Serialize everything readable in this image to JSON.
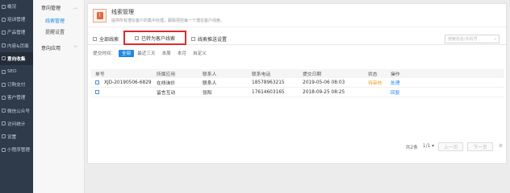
{
  "nav": [
    {
      "label": "概况",
      "icon": "overview-icon",
      "active": false
    },
    {
      "label": "培训管理",
      "icon": "training-icon",
      "active": false
    },
    {
      "label": "产品管理",
      "icon": "product-icon",
      "active": false
    },
    {
      "label": "内容&页面",
      "icon": "content-icon",
      "active": false
    },
    {
      "label": "意向收集",
      "icon": "intent-icon",
      "active": true
    },
    {
      "label": "SEO",
      "icon": "seo-icon",
      "active": false
    },
    {
      "label": "订购支付",
      "icon": "payment-icon",
      "active": false
    },
    {
      "label": "客户管理",
      "icon": "customer-icon",
      "active": false
    },
    {
      "label": "微信公众号",
      "icon": "wechat-icon",
      "active": false
    },
    {
      "label": "访问统计",
      "icon": "stats-icon",
      "active": false
    },
    {
      "label": "设置",
      "icon": "settings-icon",
      "active": false
    },
    {
      "label": "小程序管理",
      "icon": "miniprogram-icon",
      "active": false
    }
  ],
  "subnav": {
    "group1": "意向管理",
    "items": [
      "线索管理",
      "提醒设置"
    ],
    "group2": "意向应用"
  },
  "info": {
    "title": "线索管理",
    "desc": "提供所有潜在客户的集中处理，跟踪把控每一个潜在客户线索。"
  },
  "tabs": [
    {
      "label": "全部线索",
      "selected": false
    },
    {
      "label": "已转为客户线索",
      "selected": true
    },
    {
      "label": "线索推送设置",
      "selected": false
    }
  ],
  "search": {
    "placeholder": "搜索姓名/手机号"
  },
  "filters": {
    "label": "提交时间：",
    "options": [
      "全部",
      "最近三天",
      "本周",
      "本月",
      "自定义"
    ]
  },
  "table": {
    "headers": [
      "单号",
      "所属应用",
      "联系人",
      "联系电话",
      "提交日期",
      "状态",
      "操作"
    ],
    "rows": [
      {
        "id": "XJD-20190506-6829",
        "app": "在线询价",
        "contact": "联系人",
        "phone": "18578963215",
        "date": "2019-05-06 08:03",
        "status": "待审核",
        "action": "处理"
      },
      {
        "id": "",
        "app": "留言互动",
        "contact": "张阳",
        "phone": "17614603165",
        "date": "2018-09-25 08:25",
        "status": "",
        "action": "回复"
      }
    ]
  },
  "pager": {
    "total": "共2条",
    "page": "1/1",
    "prev": "上一页",
    "next": "下一页"
  },
  "colors": {
    "accent": "#1e88e5",
    "highlight": "#e02a2a",
    "status_pending": "#f39c12"
  }
}
